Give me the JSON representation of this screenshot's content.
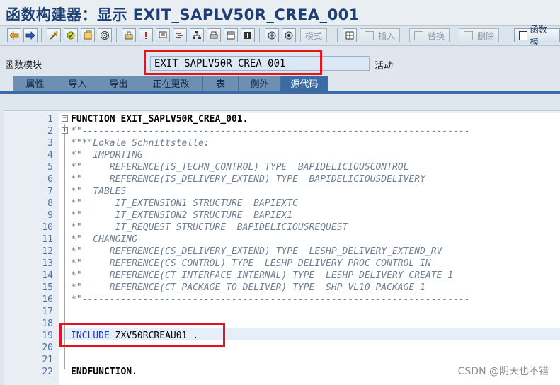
{
  "window": {
    "title": "函数构建器：显示 EXIT_SAPLV50R_CREA_001"
  },
  "toolbar": {
    "icons": [
      "back-icon",
      "forward-icon",
      "other-object-icon",
      "check-icon",
      "activate-icon",
      "where-used-icon",
      "display-object-list-icon",
      "breakpoint-icon",
      "pattern-icon",
      "pretty-printer-icon",
      "hierarchy-icon",
      "print-icon",
      "layout-icon",
      "info-icon",
      "enhance-icon",
      "enhance-display-icon"
    ],
    "mode_label": "模式",
    "insert_label": "插入",
    "replace_label": "替换",
    "delete_label": "删除",
    "func_doc_label": "函数模"
  },
  "function_module": {
    "label": "函数模块",
    "value": "EXIT_SAPLV50R_CREA_001",
    "status": "活动"
  },
  "tabs": [
    {
      "label": "属性"
    },
    {
      "label": "导入"
    },
    {
      "label": "导出"
    },
    {
      "label": "正在更改"
    },
    {
      "label": "表"
    },
    {
      "label": "例外"
    },
    {
      "label": "源代码",
      "active": true
    }
  ],
  "editor": {
    "lines": [
      {
        "n": "1",
        "text": "FUNCTION EXIT_SAPLV50R_CREA_001."
      },
      {
        "n": "2",
        "text": "*\"----------------------------------------------------------------------"
      },
      {
        "n": "3",
        "text": "*\"*\"Lokale Schnittstelle:"
      },
      {
        "n": "4",
        "text": "*\"  IMPORTING"
      },
      {
        "n": "5",
        "text": "*\"     REFERENCE(IS_TECHN_CONTROL) TYPE  BAPIDELICIOUSCONTROL"
      },
      {
        "n": "6",
        "text": "*\"     REFERENCE(IS_DELIVERY_EXTEND) TYPE  BAPIDELICIOUSDELIVERY"
      },
      {
        "n": "7",
        "text": "*\"  TABLES"
      },
      {
        "n": "8",
        "text": "*\"      IT_EXTENSION1 STRUCTURE  BAPIEXTC"
      },
      {
        "n": "9",
        "text": "*\"      IT_EXTENSION2 STRUCTURE  BAPIEX1"
      },
      {
        "n": "10",
        "text": "*\"      IT_REQUEST STRUCTURE  BAPIDELICIOUSREQUEST"
      },
      {
        "n": "11",
        "text": "*\"  CHANGING"
      },
      {
        "n": "12",
        "text": "*\"     REFERENCE(CS_DELIVERY_EXTEND) TYPE  LESHP_DELIVERY_EXTEND_RV"
      },
      {
        "n": "13",
        "text": "*\"     REFERENCE(CS_CONTROL) TYPE  LESHP_DELIVERY_PROC_CONTROL_IN"
      },
      {
        "n": "14",
        "text": "*\"     REFERENCE(CT_INTERFACE_INTERNAL) TYPE  LESHP_DELIVERY_CREATE_1"
      },
      {
        "n": "15",
        "text": "*\"     REFERENCE(CT_PACKAGE_TO_DELIVER) TYPE  SHP_VL10_PACKAGE_1"
      },
      {
        "n": "16",
        "text": "*\"----------------------------------------------------------------------"
      },
      {
        "n": "17",
        "text": ""
      },
      {
        "n": "18",
        "text": ""
      },
      {
        "n": "19",
        "kw": "INCLUDE",
        "rest": " ZXV50RCREAU01 ."
      },
      {
        "n": "20",
        "text": ""
      },
      {
        "n": "21",
        "text": ""
      },
      {
        "n": "22",
        "text": "ENDFUNCTION."
      }
    ]
  },
  "watermark": "CSDN @阴天也不错"
}
